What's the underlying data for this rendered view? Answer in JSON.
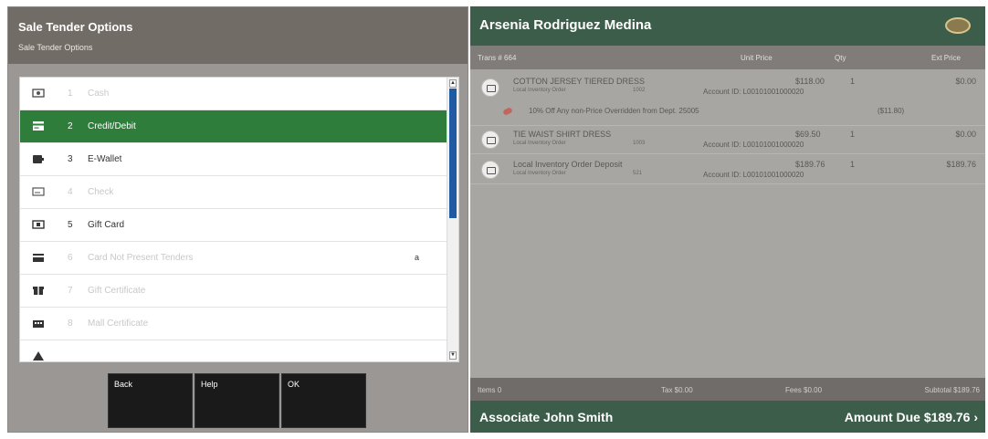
{
  "dialog": {
    "title": "Sale Tender Options",
    "subtitle": "Sale Tender Options",
    "tenders": [
      {
        "num": "1",
        "label": "Cash",
        "icon": "cash-icon",
        "state": "disabled"
      },
      {
        "num": "2",
        "label": "Credit/Debit",
        "icon": "credit-card-icon",
        "state": "selected"
      },
      {
        "num": "3",
        "label": "E-Wallet",
        "icon": "wallet-icon",
        "state": "enabled"
      },
      {
        "num": "4",
        "label": "Check",
        "icon": "check-icon",
        "state": "disabled"
      },
      {
        "num": "5",
        "label": "Gift Card",
        "icon": "gift-card-icon",
        "state": "enabled"
      },
      {
        "num": "6",
        "label": "Card Not Present Tenders",
        "icon": "card-not-present-icon",
        "state": "disabled",
        "extra": "a"
      },
      {
        "num": "7",
        "label": "Gift Certificate",
        "icon": "gift-certificate-icon",
        "state": "disabled"
      },
      {
        "num": "8",
        "label": "Mall Certificate",
        "icon": "mall-certificate-icon",
        "state": "disabled"
      }
    ],
    "buttons": {
      "back": "Back",
      "help": "Help",
      "ok": "OK"
    }
  },
  "transaction": {
    "customer_name": "Arsenia  Rodriguez Medina",
    "columns": {
      "trans": "Trans # 664",
      "unit_price": "Unit Price",
      "qty": "Qty",
      "ext_price": "Ext Price"
    },
    "items": [
      {
        "name": "COTTON JERSEY TIERED DRESS",
        "type": "Local Inventory Order",
        "sku": "1002",
        "price": "$118.00",
        "account": "Account ID: L00101001000020",
        "qty": "1",
        "ext": "$0.00"
      },
      {
        "name": "TIE WAIST SHIRT DRESS",
        "type": "Local Inventory Order",
        "sku": "1003",
        "price": "$69.50",
        "account": "Account ID: L00101001000020",
        "qty": "1",
        "ext": "$0.00"
      },
      {
        "name": "Local Inventory Order Deposit",
        "type": "Local Inventory Order",
        "sku": "521",
        "price": "$189.76",
        "account": "Account ID: L00101001000020",
        "qty": "1",
        "ext": "$189.76"
      }
    ],
    "promo": {
      "text": "10% Off Any non-Price Overridden from Dept. 25005",
      "amount": "($11.80)"
    },
    "totals": {
      "items": "Items 0",
      "tax": "Tax $0.00",
      "fees": "Fees $0.00",
      "subtotal": "Subtotal $189.76"
    },
    "associate": "Associate John  Smith",
    "amount_due": "Amount Due  $189.76 ›"
  },
  "colors": {
    "selected": "#2f7d3b",
    "header_green": "#3c5d4a",
    "scroll_thumb": "#1f5aa3"
  }
}
